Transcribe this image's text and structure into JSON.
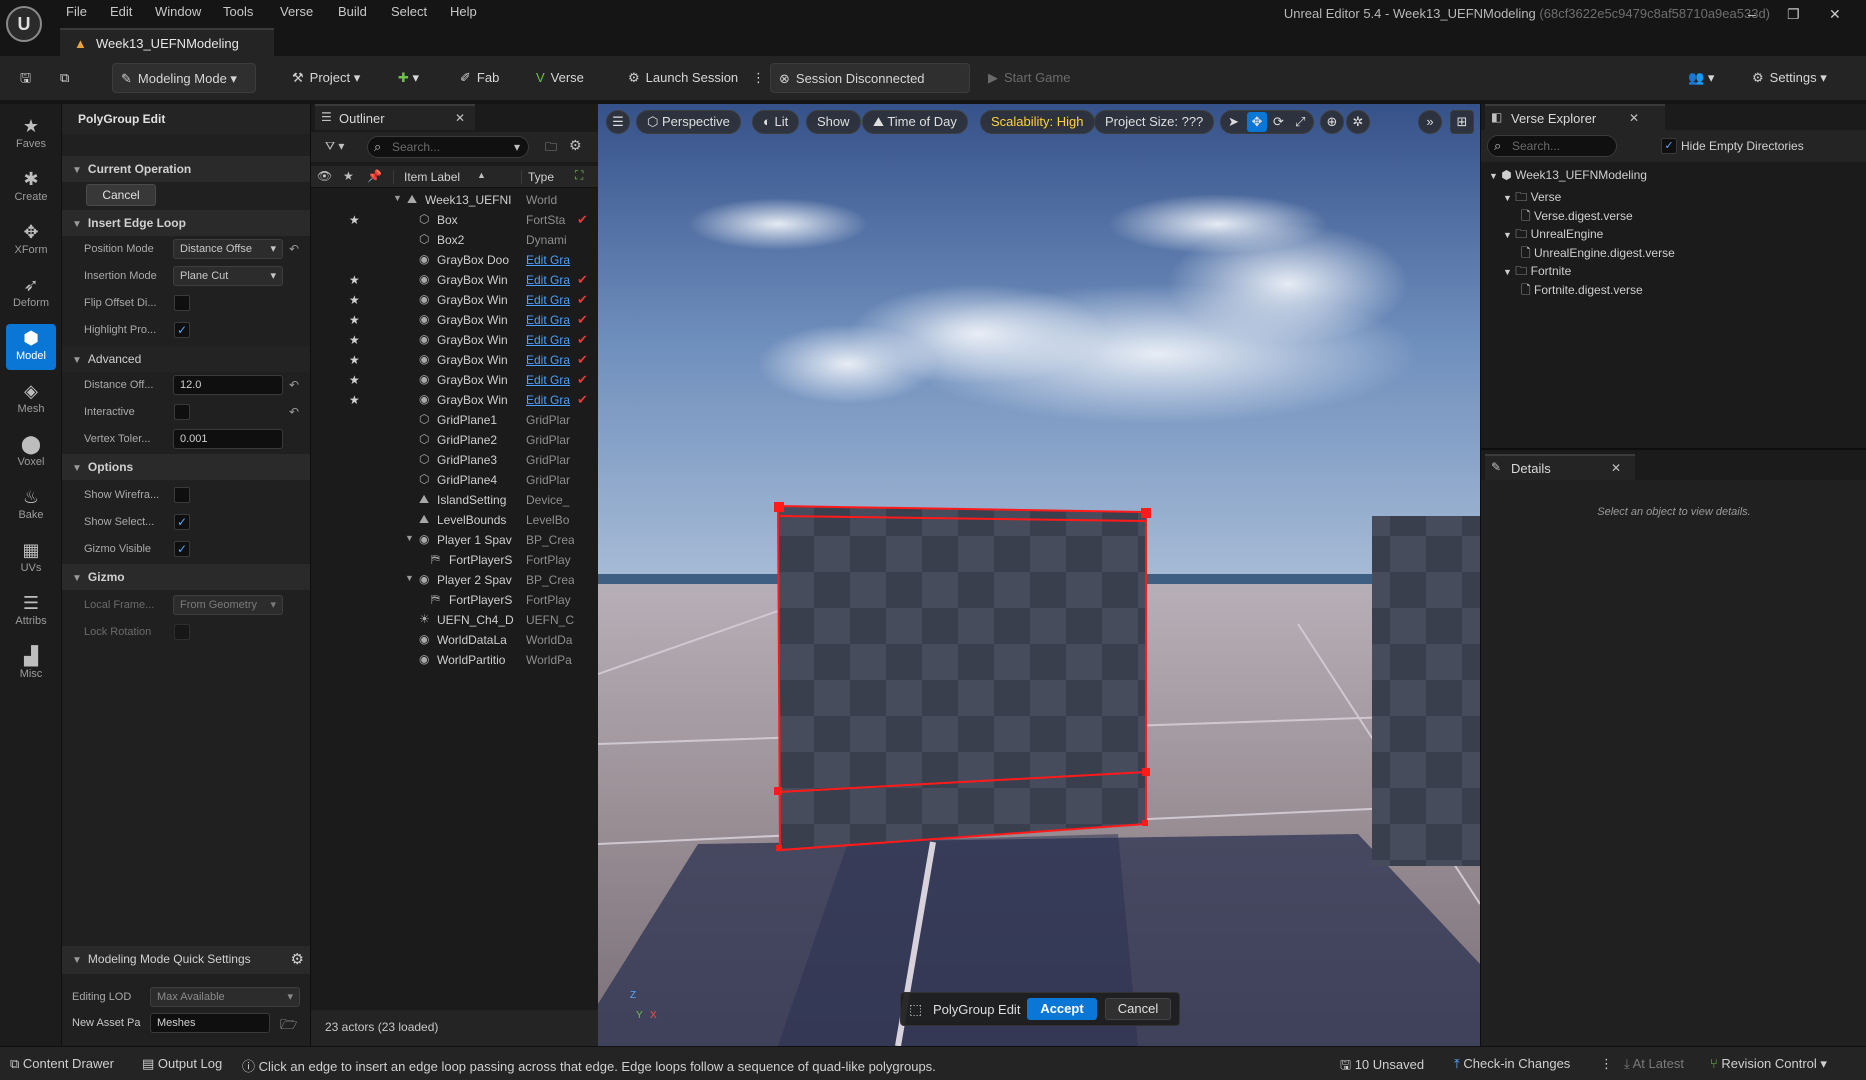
{
  "app": {
    "menu": [
      "File",
      "Edit",
      "Window",
      "Tools",
      "Verse",
      "Build",
      "Select",
      "Help"
    ],
    "doc_tab": "Week13_UEFNModeling",
    "window_title": "Unreal Editor 5.4 - Week13_UEFNModeling",
    "window_hash": "(68cf3622e5c9479c8af58710a9ea533d)",
    "logo_text": "U",
    "window_buttons": {
      "minimize": "–",
      "maximize": "❐",
      "close": "✕"
    }
  },
  "toolbar": {
    "modeling_mode": "Modeling Mode",
    "project": "Project",
    "fab": "Fab",
    "verse": "Verse",
    "launch_session": "Launch Session",
    "session_status": "Session Disconnected",
    "start_game": "Start Game",
    "settings": "Settings"
  },
  "modes": [
    {
      "label": "Faves",
      "glyph": "★"
    },
    {
      "label": "Create",
      "glyph": "✱"
    },
    {
      "label": "XForm",
      "glyph": "✥"
    },
    {
      "label": "Deform",
      "glyph": "➶"
    },
    {
      "label": "Model",
      "glyph": "⬢"
    },
    {
      "label": "Mesh",
      "glyph": "◈"
    },
    {
      "label": "Voxel",
      "glyph": "⬤"
    },
    {
      "label": "Bake",
      "glyph": "♨"
    },
    {
      "label": "UVs",
      "glyph": "▦"
    },
    {
      "label": "Attribs",
      "glyph": "☰"
    },
    {
      "label": "Misc",
      "glyph": "▟"
    }
  ],
  "tool_panel": {
    "title": "PolyGroup Edit",
    "current_operation": "Current Operation",
    "cancel": "Cancel",
    "insert_edge_loop": "Insert Edge Loop",
    "position_mode_label": "Position Mode",
    "position_mode_value": "Distance Offse",
    "insertion_mode_label": "Insertion Mode",
    "insertion_mode_value": "Plane Cut",
    "flip_offset_label": "Flip Offset Di...",
    "highlight_label": "Highlight Pro...",
    "advanced": "Advanced",
    "distance_offset_label": "Distance Off...",
    "distance_offset_value": "12.0",
    "interactive_label": "Interactive",
    "vertex_tol_label": "Vertex Toler...",
    "vertex_tol_value": "0.001",
    "options": "Options",
    "show_wireframe_label": "Show Wirefra...",
    "show_selection_label": "Show Select...",
    "gizmo_visible_label": "Gizmo Visible",
    "gizmo": "Gizmo",
    "local_frame_label": "Local Frame...",
    "local_frame_value": "From Geometry",
    "lock_rotation_label": "Lock Rotation",
    "quick_settings": "Modeling Mode Quick Settings",
    "editing_lod_label": "Editing LOD",
    "editing_lod_value": "Max Available",
    "new_asset_label": "New Asset Pa",
    "new_asset_value": "Meshes",
    "checkmark": "✓"
  },
  "outliner": {
    "title": "Outliner",
    "search_placeholder": "Search...",
    "col_label": "Item Label",
    "col_type": "Type",
    "footer": "23 actors (23 loaded)",
    "rows": [
      {
        "name": "Week13_UEFNI",
        "type": "World",
        "star": "",
        "icon": "⛰",
        "check": "",
        "link": false
      },
      {
        "name": "Box",
        "type": "FortSta",
        "star": "★",
        "icon": "⬡",
        "check": "✔",
        "link": false
      },
      {
        "name": "Box2",
        "type": "Dynami",
        "star": "",
        "icon": "⬡",
        "check": "",
        "link": false
      },
      {
        "name": "GrayBox Doo",
        "type": "Edit Gra",
        "star": "",
        "icon": "◉",
        "check": "",
        "link": true
      },
      {
        "name": "GrayBox Win",
        "type": "Edit Gra",
        "star": "★",
        "icon": "◉",
        "check": "✔",
        "link": true
      },
      {
        "name": "GrayBox Win",
        "type": "Edit Gra",
        "star": "★",
        "icon": "◉",
        "check": "✔",
        "link": true
      },
      {
        "name": "GrayBox Win",
        "type": "Edit Gra",
        "star": "★",
        "icon": "◉",
        "check": "✔",
        "link": true
      },
      {
        "name": "GrayBox Win",
        "type": "Edit Gra",
        "star": "★",
        "icon": "◉",
        "check": "✔",
        "link": true
      },
      {
        "name": "GrayBox Win",
        "type": "Edit Gra",
        "star": "★",
        "icon": "◉",
        "check": "✔",
        "link": true
      },
      {
        "name": "GrayBox Win",
        "type": "Edit Gra",
        "star": "★",
        "icon": "◉",
        "check": "✔",
        "link": true
      },
      {
        "name": "GrayBox Win",
        "type": "Edit Gra",
        "star": "★",
        "icon": "◉",
        "check": "✔",
        "link": true
      },
      {
        "name": "GridPlane1",
        "type": "GridPlar",
        "star": "",
        "icon": "⬡",
        "check": "",
        "link": false
      },
      {
        "name": "GridPlane2",
        "type": "GridPlar",
        "star": "",
        "icon": "⬡",
        "check": "",
        "link": false
      },
      {
        "name": "GridPlane3",
        "type": "GridPlar",
        "star": "",
        "icon": "⬡",
        "check": "",
        "link": false
      },
      {
        "name": "GridPlane4",
        "type": "GridPlar",
        "star": "",
        "icon": "⬡",
        "check": "",
        "link": false
      },
      {
        "name": "IslandSetting",
        "type": "Device_",
        "star": "",
        "icon": "⛰",
        "check": "",
        "link": false
      },
      {
        "name": "LevelBounds",
        "type": "LevelBo",
        "star": "",
        "icon": "⛰",
        "check": "",
        "link": false
      },
      {
        "name": "Player 1 Spav",
        "type": "BP_Crea",
        "star": "",
        "icon": "◉",
        "check": "",
        "link": false
      },
      {
        "name": "FortPlayerS",
        "type": "FortPlay",
        "star": "",
        "icon": "⛿",
        "check": "",
        "link": false
      },
      {
        "name": "Player 2 Spav",
        "type": "BP_Crea",
        "star": "",
        "icon": "◉",
        "check": "",
        "link": false
      },
      {
        "name": "FortPlayerS",
        "type": "FortPlay",
        "star": "",
        "icon": "⛿",
        "check": "",
        "link": false
      },
      {
        "name": "UEFN_Ch4_D",
        "type": "UEFN_C",
        "star": "",
        "icon": "☀",
        "check": "",
        "link": false
      },
      {
        "name": "WorldDataLa",
        "type": "WorldDa",
        "star": "",
        "icon": "◉",
        "check": "",
        "link": false
      },
      {
        "name": "WorldPartitio",
        "type": "WorldPa",
        "star": "",
        "icon": "◉",
        "check": "",
        "link": false
      }
    ]
  },
  "viewport": {
    "perspective": "Perspective",
    "lit": "Lit",
    "show": "Show",
    "time_of_day": "Time of Day",
    "scalability": "Scalability: High",
    "project_size": "Project Size: ???",
    "polygroup_edit": "PolyGroup Edit",
    "accept": "Accept",
    "cancel": "Cancel",
    "axis_z": "Z",
    "axis_y": "Y",
    "axis_x": "X",
    "colors": {
      "sky_top": "#3e5a8e",
      "sky_mid": "#8aa6c8",
      "ground": "#9a8e92",
      "selection": "#ff1a1a"
    }
  },
  "verse_explorer": {
    "title": "Verse Explorer",
    "search_placeholder": "Search...",
    "hide_empty": "Hide Empty Directories",
    "root": "Week13_UEFNModeling",
    "items": [
      {
        "label": "Verse",
        "kind": "folder"
      },
      {
        "label": "Verse.digest.verse",
        "kind": "file"
      },
      {
        "label": "UnrealEngine",
        "kind": "folder"
      },
      {
        "label": "UnrealEngine.digest.verse",
        "kind": "file"
      },
      {
        "label": "Fortnite",
        "kind": "folder"
      },
      {
        "label": "Fortnite.digest.verse",
        "kind": "file"
      }
    ]
  },
  "details": {
    "title": "Details",
    "empty": "Select an object to view details."
  },
  "status": {
    "content_drawer": "Content Drawer",
    "output_log": "Output Log",
    "hint": "Click an edge to insert an edge loop passing across that edge. Edge loops follow a sequence of quad-like polygroups.",
    "unsaved": "10 Unsaved",
    "checkin": "Check-in Changes",
    "at_latest": "At Latest",
    "revision": "Revision Control"
  }
}
